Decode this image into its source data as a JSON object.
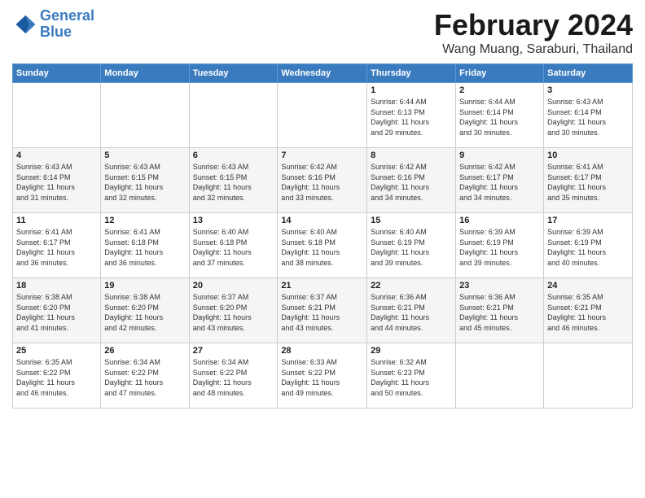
{
  "header": {
    "logo_line1": "General",
    "logo_line2": "Blue",
    "month": "February 2024",
    "location": "Wang Muang, Saraburi, Thailand"
  },
  "days_of_week": [
    "Sunday",
    "Monday",
    "Tuesday",
    "Wednesday",
    "Thursday",
    "Friday",
    "Saturday"
  ],
  "weeks": [
    [
      {
        "day": "",
        "info": ""
      },
      {
        "day": "",
        "info": ""
      },
      {
        "day": "",
        "info": ""
      },
      {
        "day": "",
        "info": ""
      },
      {
        "day": "1",
        "info": "Sunrise: 6:44 AM\nSunset: 6:13 PM\nDaylight: 11 hours\nand 29 minutes."
      },
      {
        "day": "2",
        "info": "Sunrise: 6:44 AM\nSunset: 6:14 PM\nDaylight: 11 hours\nand 30 minutes."
      },
      {
        "day": "3",
        "info": "Sunrise: 6:43 AM\nSunset: 6:14 PM\nDaylight: 11 hours\nand 30 minutes."
      }
    ],
    [
      {
        "day": "4",
        "info": "Sunrise: 6:43 AM\nSunset: 6:14 PM\nDaylight: 11 hours\nand 31 minutes."
      },
      {
        "day": "5",
        "info": "Sunrise: 6:43 AM\nSunset: 6:15 PM\nDaylight: 11 hours\nand 32 minutes."
      },
      {
        "day": "6",
        "info": "Sunrise: 6:43 AM\nSunset: 6:15 PM\nDaylight: 11 hours\nand 32 minutes."
      },
      {
        "day": "7",
        "info": "Sunrise: 6:42 AM\nSunset: 6:16 PM\nDaylight: 11 hours\nand 33 minutes."
      },
      {
        "day": "8",
        "info": "Sunrise: 6:42 AM\nSunset: 6:16 PM\nDaylight: 11 hours\nand 34 minutes."
      },
      {
        "day": "9",
        "info": "Sunrise: 6:42 AM\nSunset: 6:17 PM\nDaylight: 11 hours\nand 34 minutes."
      },
      {
        "day": "10",
        "info": "Sunrise: 6:41 AM\nSunset: 6:17 PM\nDaylight: 11 hours\nand 35 minutes."
      }
    ],
    [
      {
        "day": "11",
        "info": "Sunrise: 6:41 AM\nSunset: 6:17 PM\nDaylight: 11 hours\nand 36 minutes."
      },
      {
        "day": "12",
        "info": "Sunrise: 6:41 AM\nSunset: 6:18 PM\nDaylight: 11 hours\nand 36 minutes."
      },
      {
        "day": "13",
        "info": "Sunrise: 6:40 AM\nSunset: 6:18 PM\nDaylight: 11 hours\nand 37 minutes."
      },
      {
        "day": "14",
        "info": "Sunrise: 6:40 AM\nSunset: 6:18 PM\nDaylight: 11 hours\nand 38 minutes."
      },
      {
        "day": "15",
        "info": "Sunrise: 6:40 AM\nSunset: 6:19 PM\nDaylight: 11 hours\nand 39 minutes."
      },
      {
        "day": "16",
        "info": "Sunrise: 6:39 AM\nSunset: 6:19 PM\nDaylight: 11 hours\nand 39 minutes."
      },
      {
        "day": "17",
        "info": "Sunrise: 6:39 AM\nSunset: 6:19 PM\nDaylight: 11 hours\nand 40 minutes."
      }
    ],
    [
      {
        "day": "18",
        "info": "Sunrise: 6:38 AM\nSunset: 6:20 PM\nDaylight: 11 hours\nand 41 minutes."
      },
      {
        "day": "19",
        "info": "Sunrise: 6:38 AM\nSunset: 6:20 PM\nDaylight: 11 hours\nand 42 minutes."
      },
      {
        "day": "20",
        "info": "Sunrise: 6:37 AM\nSunset: 6:20 PM\nDaylight: 11 hours\nand 43 minutes."
      },
      {
        "day": "21",
        "info": "Sunrise: 6:37 AM\nSunset: 6:21 PM\nDaylight: 11 hours\nand 43 minutes."
      },
      {
        "day": "22",
        "info": "Sunrise: 6:36 AM\nSunset: 6:21 PM\nDaylight: 11 hours\nand 44 minutes."
      },
      {
        "day": "23",
        "info": "Sunrise: 6:36 AM\nSunset: 6:21 PM\nDaylight: 11 hours\nand 45 minutes."
      },
      {
        "day": "24",
        "info": "Sunrise: 6:35 AM\nSunset: 6:21 PM\nDaylight: 11 hours\nand 46 minutes."
      }
    ],
    [
      {
        "day": "25",
        "info": "Sunrise: 6:35 AM\nSunset: 6:22 PM\nDaylight: 11 hours\nand 46 minutes."
      },
      {
        "day": "26",
        "info": "Sunrise: 6:34 AM\nSunset: 6:22 PM\nDaylight: 11 hours\nand 47 minutes."
      },
      {
        "day": "27",
        "info": "Sunrise: 6:34 AM\nSunset: 6:22 PM\nDaylight: 11 hours\nand 48 minutes."
      },
      {
        "day": "28",
        "info": "Sunrise: 6:33 AM\nSunset: 6:22 PM\nDaylight: 11 hours\nand 49 minutes."
      },
      {
        "day": "29",
        "info": "Sunrise: 6:32 AM\nSunset: 6:23 PM\nDaylight: 11 hours\nand 50 minutes."
      },
      {
        "day": "",
        "info": ""
      },
      {
        "day": "",
        "info": ""
      }
    ]
  ]
}
